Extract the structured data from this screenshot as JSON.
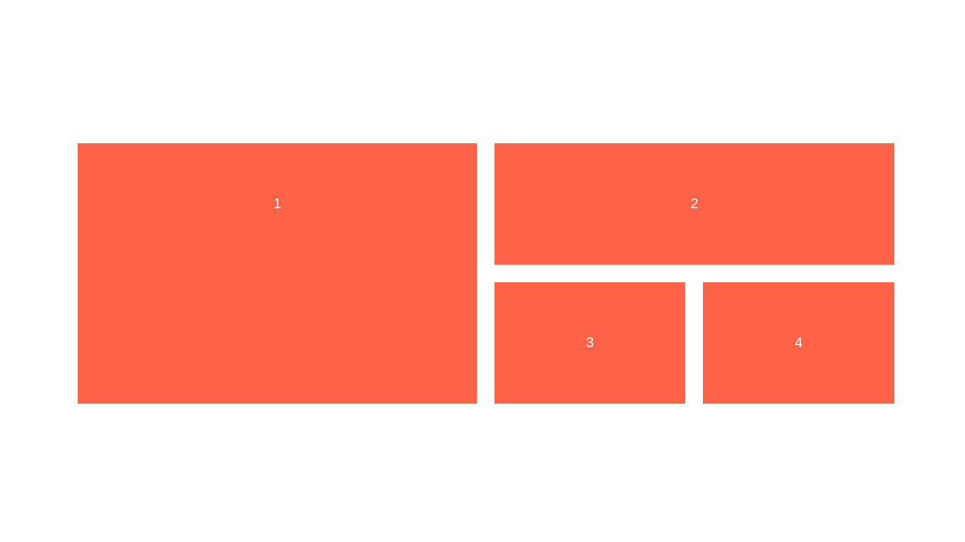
{
  "tiles": [
    {
      "label": "1"
    },
    {
      "label": "2"
    },
    {
      "label": "3"
    },
    {
      "label": "4"
    }
  ],
  "colors": {
    "background": "#ffffff",
    "tile": "#ff6347",
    "tile_text": "#ffffff"
  }
}
